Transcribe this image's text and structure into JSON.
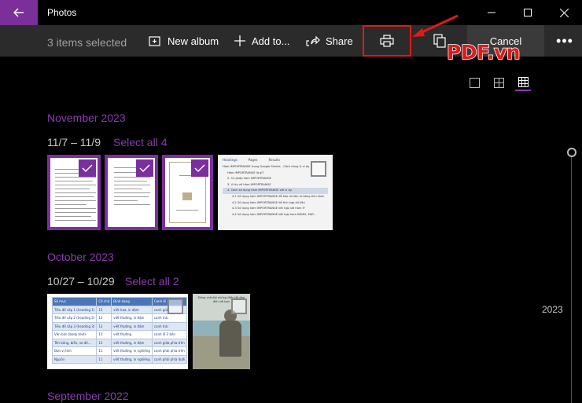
{
  "window": {
    "app_title": "Photos",
    "back_icon": "arrow-left-icon",
    "minimize_icon": "minimize-icon",
    "maximize_icon": "maximize-icon",
    "close_icon": "close-icon"
  },
  "commandbar": {
    "selection_status": "3 items selected",
    "new_album": "New album",
    "add_to": "Add to...",
    "share": "Share",
    "print_icon": "printer-icon",
    "copy_icon": "copy-icon",
    "cancel": "Cancel",
    "more": "•••"
  },
  "watermark": "PDF.vn",
  "view_modes": [
    "single-view-icon",
    "medium-grid-icon",
    "small-grid-icon"
  ],
  "groups": [
    {
      "month": "November 2023",
      "range": "11/7 – 11/9",
      "select_all": "Select all 4"
    },
    {
      "month": "October 2023",
      "range": "10/27 – 10/29",
      "select_all": "Select all 2"
    },
    {
      "month": "September 2022"
    }
  ],
  "timeline": {
    "year_label": "2023"
  },
  "screenshot_thumb": {
    "tabs": [
      "Headings",
      "Pages",
      "Results"
    ],
    "items": [
      "Hàm IMPORTRANGE trong Google Sheets - Cách dùng & ví dụ",
      "Hàm IMPORTRANGE là gì?",
      "2. Cú pháp hàm IMPORTRANGE",
      "3. Ví dụ về hàm IMPORTRANGE",
      "4. Cách sử dụng hàm IMPORTRANGE với ví dụ",
      "4.1 Sử dụng hàm IMPORTRANGE để kéo dữ liệu từ bảng tính khác",
      "4.2 Sử dụng hàm IMPORTRANGE để tích hợp dữ liệu",
      "4.3 Sử dụng hàm IMPORTRANGE kết hợp với hàm IF",
      "4.4 Sử dụng hàm IMPORTRANGE kết hợp hàm INDEX, MAT..."
    ]
  },
  "table_thumb": {
    "headers": [
      "Số mục",
      "Cỡ chữ",
      "Định dạng",
      "Canh lề"
    ],
    "rows": [
      [
        "Tiêu đề cấp 1 (heading 1)",
        "15",
        "viết hoa, in đậm",
        "canh giữa"
      ],
      [
        "Tiêu đề cấp 2 (heading 2)",
        "13",
        "viết thường, in đậm",
        "canh trái"
      ],
      [
        "Tiêu đề cấp 3 (heading 3)",
        "13",
        "viết thường, in đậm",
        "canh trái"
      ],
      [
        "Văn bản (body text)",
        "13",
        "viết thường",
        "canh lề 2 bên"
      ],
      [
        "Tên bảng, biểu, sơ đồ...",
        "13",
        "viết thường, in đậm",
        "canh giữa phía trên"
      ],
      [
        "Đơn vị tính",
        "11",
        "viết thường, in nghiêng",
        "canh phải phía trên"
      ],
      [
        "Nguồn",
        "11",
        "viết thường, in nghiêng",
        "canh phải phía dưới"
      ]
    ]
  },
  "photo_thumb": {
    "caption": "Đừng chờ đợi những điều tốt đẹp đến với bạn"
  }
}
